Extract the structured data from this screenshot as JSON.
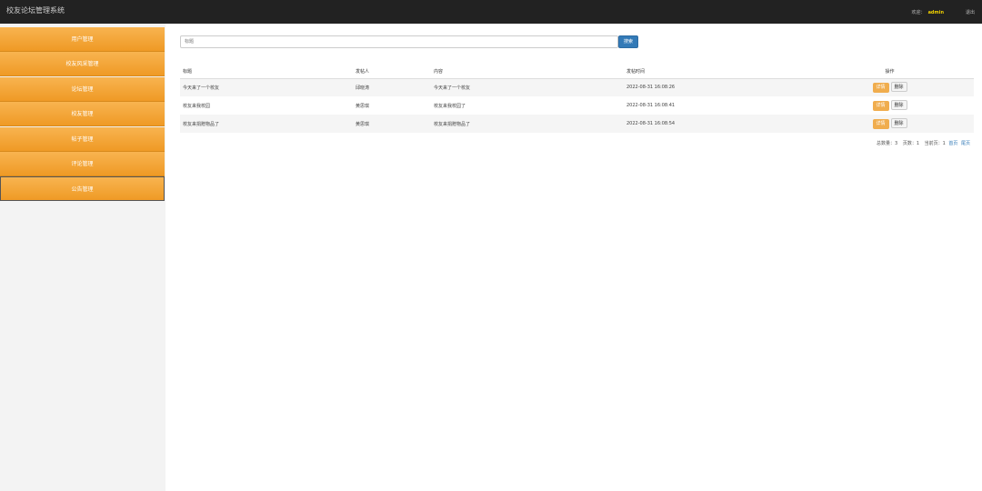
{
  "topbar": {
    "brand": "校友论坛管理系统",
    "welcome": "欢迎：",
    "user": "admin",
    "logout": "退出"
  },
  "sidebar": {
    "items": [
      {
        "label": "用户管理"
      },
      {
        "label": "校友风采管理"
      },
      {
        "label": "论坛管理"
      },
      {
        "label": "校友管理"
      },
      {
        "label": "帖子管理"
      },
      {
        "label": "评论管理"
      },
      {
        "label": "公告管理"
      }
    ]
  },
  "search": {
    "placeholder": "标题",
    "button": "搜索"
  },
  "table": {
    "headers": [
      "标题",
      "发帖人",
      "内容",
      "发帖时间",
      "操作"
    ],
    "rows": [
      {
        "title": "今天来了一个校友",
        "author": "邱晓涛",
        "content": "今天来了一个校友",
        "time": "2022-08-31 16:08:26",
        "detail": "详情",
        "delete": "删除"
      },
      {
        "title": "校友来我校园",
        "author": "黄思琪",
        "content": "校友来我校园了",
        "time": "2022-08-31 16:08:41",
        "detail": "详情",
        "delete": "删除"
      },
      {
        "title": "校友来捐赠物品了",
        "author": "黄思琪",
        "content": "校友来捐赠物品了",
        "time": "2022-08-31 16:08:54",
        "detail": "详情",
        "delete": "删除"
      }
    ]
  },
  "pager": {
    "total": "总数量：3",
    "pages": "页数：1",
    "current": "当前页：1",
    "first": "首页",
    "last": "尾页"
  }
}
